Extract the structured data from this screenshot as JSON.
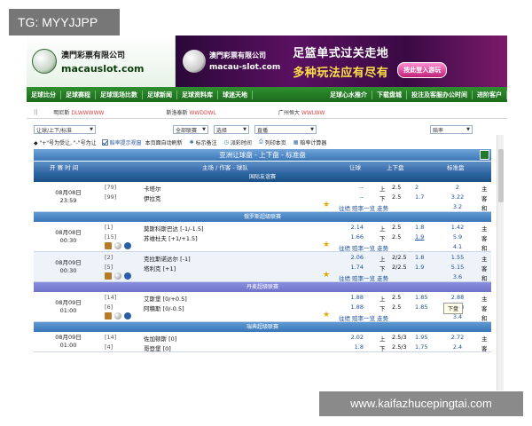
{
  "overlay": {
    "tag": "TG: MYYJJPP",
    "watermark": "www.kaifazhucepingtai.com"
  },
  "banner": {
    "left_cn": "澳門彩票有限公司",
    "left_en": "macauslot.com",
    "right_cn": "澳門彩票有限公司",
    "right_en": "macau-slot.com",
    "slogan1": "足篮单式过关走地",
    "slogan2": "多种玩法应有尽有",
    "enter_label": "按此登入游玩"
  },
  "nav": {
    "items": [
      "足球比分",
      "足球赛程",
      "足球现场比数",
      "足球新闻",
      "足球资料库",
      "球迷天地"
    ],
    "right_items": [
      "足球心水推介",
      "下载盘城",
      "投注及客服办公时间",
      "进阶客户"
    ]
  },
  "ticker": {
    "pause": "||",
    "items": [
      {
        "text": "明尼斯",
        "en": "DLWWWWW"
      },
      {
        "text": "斯洛泰斯",
        "en": "WWDDWL"
      },
      {
        "text": "广州恒大",
        "en": "WWLWW"
      }
    ]
  },
  "filters": {
    "sel1": "让球/上下/标准",
    "sel2": "全部联赛",
    "sel3": "选择",
    "sel4": "直播",
    "sel5": "赔率",
    "tools": [
      "标示备注",
      "派彩时间",
      "列印本页",
      "赔率计算器"
    ],
    "legend": "◆ \"+\"号为受让, \"-\"号为让",
    "checkbox_label": "赔率提示视窗",
    "refresh_label": "本页面自动刷新"
  },
  "table": {
    "title": "亚洲让球盘 - 上下盘 - 标准盘",
    "headers": {
      "time": "开 赛 时 间",
      "teams": "主场 / 作客 - 球队",
      "handicap": "让球",
      "overunder": "上下盘",
      "standard": "标准盘"
    },
    "tooltip": "下盘",
    "links": "往绩  赔率一览  走势",
    "sections": [
      {
        "league": "国际友谊赛",
        "style": "dark",
        "matches": [
          {
            "date": "08月08日",
            "time": "23:59",
            "lines": [
              {
                "rank": "[79]",
                "team": "卡塔尔",
                "oc": "--",
                "dir": "上",
                "hc": "2.5",
                "hs": "2",
                "sd": "2",
                "ha": "主"
              },
              {
                "rank": "[99]",
                "team": "伊拉克",
                "oc": "--",
                "dir": "下",
                "hc": "2.5",
                "hs": "1.7",
                "sd": "3.22",
                "ha": "客"
              },
              {
                "type": "links",
                "sd": "3.2",
                "ha": "和"
              }
            ]
          }
        ]
      },
      {
        "league": "俄罗斯超级联赛",
        "style": "blue",
        "matches": [
          {
            "date": "08月08日",
            "time": "00:30",
            "lines": [
              {
                "rank": "[1]",
                "team": "莫斯科斯巴达 [-1/-1.5]",
                "oc": "2.14",
                "dir": "上",
                "hc": "2.5",
                "hs": "1.8",
                "sd": "1.42",
                "ha": "主"
              },
              {
                "rank": "[15]",
                "team": "苏维杜夫 [+1/+1.5]",
                "oc": "1.66",
                "dir": "下",
                "hc": "2.5",
                "hs": "1.9",
                "sd": "5.9",
                "ha": "客",
                "hs_u": true
              },
              {
                "type": "links",
                "icons": true,
                "sd": "4.1",
                "ha": "和"
              }
            ]
          },
          {
            "date": "08月09日",
            "time": "00:30",
            "lines": [
              {
                "rank": "[2]",
                "team": "克拉斯诺达尔 [-1]",
                "oc": "2.06",
                "dir": "上",
                "hc": "2/2.5",
                "hs": "1.8",
                "sd": "1.55",
                "ha": "主"
              },
              {
                "rank": "[5]",
                "team": "塔利克 [+1]",
                "oc": "1.74",
                "dir": "下",
                "hc": "2/2.5",
                "hs": "1.9",
                "sd": "5.15",
                "ha": "客"
              },
              {
                "type": "links",
                "icons": true,
                "sd": "3.6",
                "ha": "和"
              }
            ]
          }
        ]
      },
      {
        "league": "丹麦超级联赛",
        "style": "purple",
        "matches": [
          {
            "date": "08月09日",
            "time": "01:00",
            "lines": [
              {
                "rank": "[14]",
                "team": "艾斯堡 [0/+0.5]",
                "oc": "1.88",
                "dir": "上",
                "hc": "2.5",
                "hs": "1.85",
                "sd": "2.88",
                "ha": "主"
              },
              {
                "rank": "[6]",
                "team": "阿積斯 [0/-0.5]",
                "oc": "1.88",
                "dir": "下",
                "hc": "2.5",
                "hs": "1.85",
                "sd": "2.08",
                "ha": "客"
              },
              {
                "type": "links",
                "icons": true,
                "sd": "3.4",
                "ha": "和"
              }
            ]
          }
        ]
      },
      {
        "league": "瑞典超级联赛",
        "style": "blue",
        "matches": [
          {
            "date": "08月09日",
            "time": "01:00",
            "lines": [
              {
                "rank": "[14]",
                "team": "佐加顿斯 [0]",
                "oc": "2.02",
                "dir": "上",
                "hc": "2.5/3",
                "hs": "1.95",
                "sd": "2.72",
                "ha": "主"
              },
              {
                "rank": "[4]",
                "team": "哥登堡 [0]",
                "oc": "1.8",
                "dir": "下",
                "hc": "2.5/3",
                "hs": "1.75",
                "sd": "2.4",
                "ha": "客"
              }
            ]
          }
        ]
      }
    ]
  }
}
